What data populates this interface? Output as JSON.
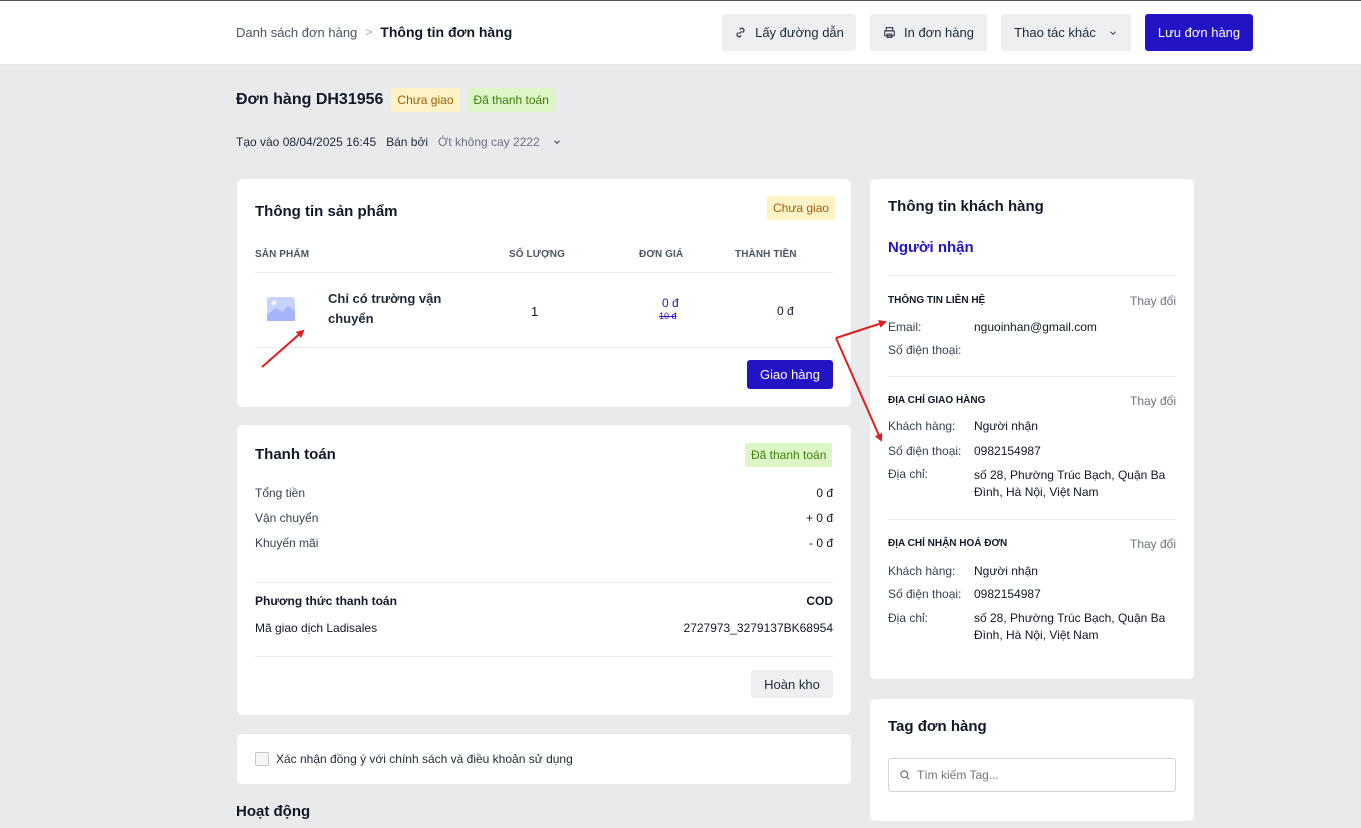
{
  "breadcrumb": {
    "parent": "Danh sách đơn hàng",
    "current": "Thông tin đơn hàng"
  },
  "toolbar": {
    "get_link": "Lấy đường dẫn",
    "print": "In đơn hàng",
    "more": "Thao tác khác",
    "save": "Lưu đơn hàng"
  },
  "order": {
    "title": "Đơn hàng DH31956",
    "status_delivery": "Chưa giao",
    "status_payment": "Đã thanh toán",
    "created_label": "Tạo vào 08/04/2025 16:45",
    "sold_by_label": "Bán bởi",
    "seller": "Ớt không cay 2222"
  },
  "product": {
    "title": "Thông tin sản phẩm",
    "status": "Chưa giao",
    "columns": {
      "product": "SẢN PHẨM",
      "qty": "SỐ LƯỢNG",
      "price": "ĐƠN GIÁ",
      "total": "THÀNH TIỀN"
    },
    "item": {
      "name": "Chỉ có trường vận chuyển",
      "qty": "1",
      "price": "0 đ",
      "old_price": "10 đ",
      "total": "0 đ"
    },
    "ship_button": "Giao hàng"
  },
  "payment": {
    "title": "Thanh toán",
    "status": "Đã thanh toán",
    "rows": [
      {
        "label": "Tổng tiền",
        "value": "0 đ"
      },
      {
        "label": "Vận chuyển",
        "value": "+ 0 đ"
      },
      {
        "label": "Khuyến mãi",
        "value": "- 0 đ"
      }
    ],
    "method_label": "Phương thức thanh toán",
    "method_value": "COD",
    "txn_label": "Mã giao dịch Ladisales",
    "txn_value": "2727973_3279137BK68954",
    "restock_button": "Hoàn kho"
  },
  "terms": {
    "label": "Xác nhận đồng ý với chính sách và điều khoản sử dụng"
  },
  "activity": {
    "title": "Hoạt động"
  },
  "customer": {
    "title": "Thông tin khách hàng",
    "name": "Người nhận",
    "contact": {
      "heading": "THÔNG TIN LIÊN HỆ",
      "change": "Thay đổi",
      "email_label": "Email:",
      "email": "nguoinhan@gmail.com",
      "phone_label": "Số điện thoại:"
    },
    "shipping": {
      "heading": "ĐỊA CHỈ GIAO HÀNG",
      "change": "Thay đổi",
      "customer_label": "Khách hàng:",
      "customer": "Người nhận",
      "phone_label": "Số điện thoại:",
      "phone": "0982154987",
      "address_label": "Địa chỉ:",
      "address": "số 28, Phường Trúc Bạch, Quận Ba Đình, Hà Nội, Việt Nam"
    },
    "billing": {
      "heading": "ĐỊA CHỈ NHẬN HOÁ ĐƠN",
      "change": "Thay đổi",
      "customer_label": "Khách hàng:",
      "customer": "Người nhận",
      "phone_label": "Số điện thoại:",
      "phone": "0982154987",
      "address_label": "Địa chỉ:",
      "address": "số 28, Phường Trúc Bạch, Quận Ba Đình, Hà Nội, Việt Nam"
    }
  },
  "tags": {
    "title": "Tag đơn hàng",
    "search_placeholder": "Tìm kiếm Tag..."
  },
  "colors": {
    "primary": "#2214c4",
    "yellow_badge": "#fdf3c7",
    "green_badge": "#dcf7c5",
    "annotation_arrow": "#e11d1d"
  },
  "icons": [
    "link-icon",
    "printer-icon",
    "chevron-down-icon",
    "image-placeholder-icon",
    "search-icon"
  ]
}
